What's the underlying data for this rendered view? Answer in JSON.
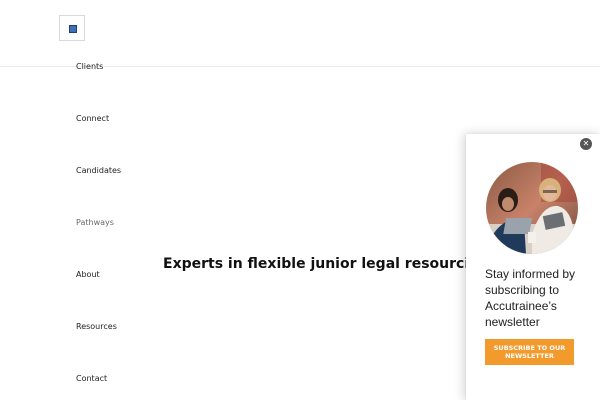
{
  "nav": {
    "items": [
      {
        "label": "Clients"
      },
      {
        "label": "Connect"
      },
      {
        "label": "Candidates"
      },
      {
        "label": "Pathways"
      },
      {
        "label": "About"
      },
      {
        "label": "Resources"
      },
      {
        "label": "Contact"
      }
    ]
  },
  "hero": {
    "title": "Experts in flexible junior legal resourcing"
  },
  "popup": {
    "close_glyph": "✕",
    "message": "Stay informed by subscribing to Accutrainee’s newsletter",
    "button_label": "SUBSCRIBE TO OUR NEWSLETTER",
    "accent_color": "#f39a2c"
  },
  "icons": {
    "logo": "logo-icon",
    "close": "close-icon"
  }
}
